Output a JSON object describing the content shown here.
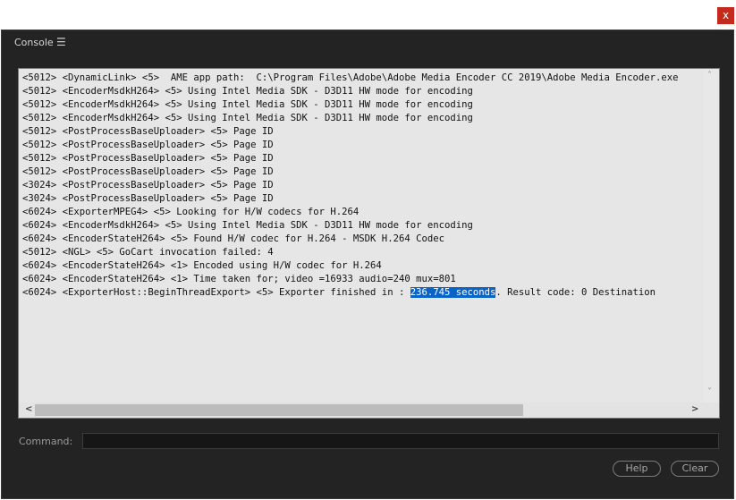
{
  "window": {
    "close_glyph": "x"
  },
  "panel": {
    "title": "Console",
    "menu_icon": "hamburger-menu-icon"
  },
  "log": {
    "lines": [
      "<5012> <DynamicLink> <5>  AME app path:  C:\\Program Files\\Adobe\\Adobe Media Encoder CC 2019\\Adobe Media Encoder.exe",
      "<5012> <EncoderMsdkH264> <5> Using Intel Media SDK - D3D11 HW mode for encoding",
      "<5012> <EncoderMsdkH264> <5> Using Intel Media SDK - D3D11 HW mode for encoding",
      "<5012> <EncoderMsdkH264> <5> Using Intel Media SDK - D3D11 HW mode for encoding",
      "<5012> <PostProcessBaseUploader> <5> Page ID",
      "<5012> <PostProcessBaseUploader> <5> Page ID",
      "<5012> <PostProcessBaseUploader> <5> Page ID",
      "<5012> <PostProcessBaseUploader> <5> Page ID",
      "<3024> <PostProcessBaseUploader> <5> Page ID",
      "<3024> <PostProcessBaseUploader> <5> Page ID",
      "<6024> <ExporterMPEG4> <5> Looking for H/W codecs for H.264",
      "<6024> <EncoderMsdkH264> <5> Using Intel Media SDK - D3D11 HW mode for encoding",
      "<6024> <EncoderStateH264> <5> Found H/W codec for H.264 - MSDK H.264 Codec",
      "<5012> <NGL> <5> GoCart invocation failed: 4",
      "<6024> <EncoderStateH264> <1> Encoded using H/W codec for H.264",
      "<6024> <EncoderStateH264> <1> Time taken for; video =16933 audio=240 mux=801"
    ],
    "last_line": {
      "before": "<6024> <ExporterHost::BeginThreadExport> <5> Exporter finished in : ",
      "selected": "236.745 seconds",
      "after": ". Result code: 0 Destination"
    },
    "scroll_up_glyph": "˄",
    "scroll_down_glyph": "˅",
    "scroll_left_glyph": "<",
    "scroll_right_glyph": ">"
  },
  "command": {
    "label": "Command:",
    "value": ""
  },
  "buttons": {
    "help": "Help",
    "clear": "Clear"
  },
  "colors": {
    "selection": "#0a64c8",
    "close": "#c42b1c",
    "panel_bg": "#232323",
    "log_bg": "#e6e6e6"
  }
}
